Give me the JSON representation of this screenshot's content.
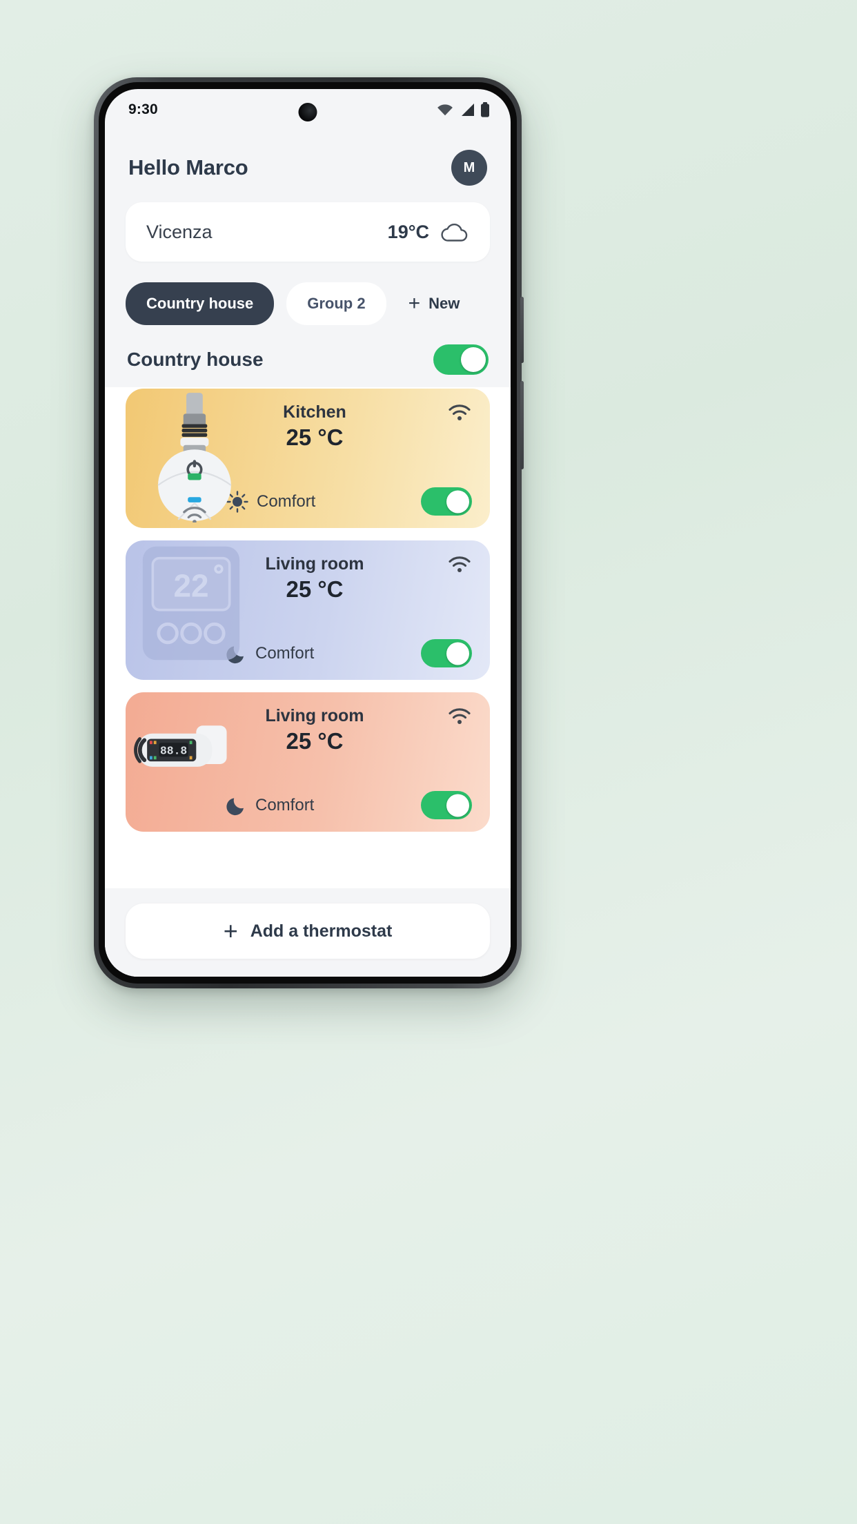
{
  "status_bar": {
    "time": "9:30",
    "icons": [
      "wifi-icon",
      "cellular-signal-icon",
      "battery-icon"
    ]
  },
  "header": {
    "greeting": "Hello Marco",
    "avatar_initial": "M"
  },
  "weather": {
    "city": "Vicenza",
    "temperature": "19°C",
    "icon": "cloud-icon"
  },
  "group_tabs": [
    {
      "label": "Country house",
      "active": true
    },
    {
      "label": "Group 2",
      "active": false
    },
    {
      "label": "New",
      "active": false,
      "icon": "plus-icon"
    }
  ],
  "group_header": {
    "title": "Country house",
    "power_on": true
  },
  "devices": [
    {
      "room": "Kitchen",
      "temperature": "25 °C",
      "mode": "Comfort",
      "mode_icon": "sun-icon",
      "wifi_icon": "wifi-icon",
      "toggle_on": true,
      "art": "thermostatic-valve-icon",
      "color": "#f2c873"
    },
    {
      "room": "Living room",
      "temperature": "25 °C",
      "mode": "Comfort",
      "mode_icon": "moon-icon",
      "wifi_icon": "wifi-icon",
      "toggle_on": true,
      "art": "wall-panel-icon",
      "color": "#b9c3e8"
    },
    {
      "room": "Living room",
      "temperature": "25 °C",
      "mode": "Comfort",
      "mode_icon": "moon-icon",
      "wifi_icon": "wifi-icon",
      "toggle_on": true,
      "art": "digital-display-thermostat-icon",
      "color": "#f3ab93"
    }
  ],
  "footer": {
    "add_label": "Add a thermostat",
    "add_icon": "plus-icon"
  },
  "colors": {
    "accent_green": "#2bbf6a",
    "dark_navy": "#36404f",
    "text_primary": "#2e3a4a",
    "page_background": "#e2eee6"
  }
}
